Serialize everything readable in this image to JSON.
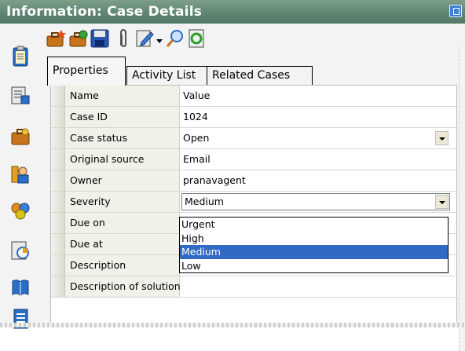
{
  "window": {
    "title": "Information: Case Details"
  },
  "toolbar": {
    "icons": [
      "new-case-icon",
      "refresh-case-icon",
      "save-icon",
      "attach-icon",
      "edit-icon",
      "search-icon",
      "reload-icon"
    ]
  },
  "sidebar": {
    "icons": [
      "clipboard-icon",
      "case-list-icon",
      "briefcase-icon",
      "agents-icon",
      "groups-icon",
      "reports-icon",
      "knowledge-icon",
      "document-icon",
      "user-icon"
    ]
  },
  "tabs": [
    {
      "label": "Properties",
      "active": true
    },
    {
      "label": "Activity List",
      "active": false
    },
    {
      "label": "Related Cases",
      "active": false
    }
  ],
  "grid": {
    "header": {
      "name": "Name",
      "value": "Value"
    },
    "rows": [
      {
        "name": "Case ID",
        "value": "1024"
      },
      {
        "name": "Case status",
        "value": "Open"
      },
      {
        "name": "Original source",
        "value": "Email"
      },
      {
        "name": "Owner",
        "value": "pranavagent"
      },
      {
        "name": "Severity",
        "value": "Medium"
      },
      {
        "name": "Due on",
        "value": ""
      },
      {
        "name": "Due at",
        "value": ""
      },
      {
        "name": "Description",
        "value": ""
      },
      {
        "name": "Description of solution",
        "value": ""
      }
    ]
  },
  "severity_dropdown": {
    "options": [
      "Urgent",
      "High",
      "Medium",
      "Low"
    ],
    "selected": "Medium"
  },
  "colors": {
    "titlebar": "#5f8672",
    "selection": "#316ac5"
  }
}
